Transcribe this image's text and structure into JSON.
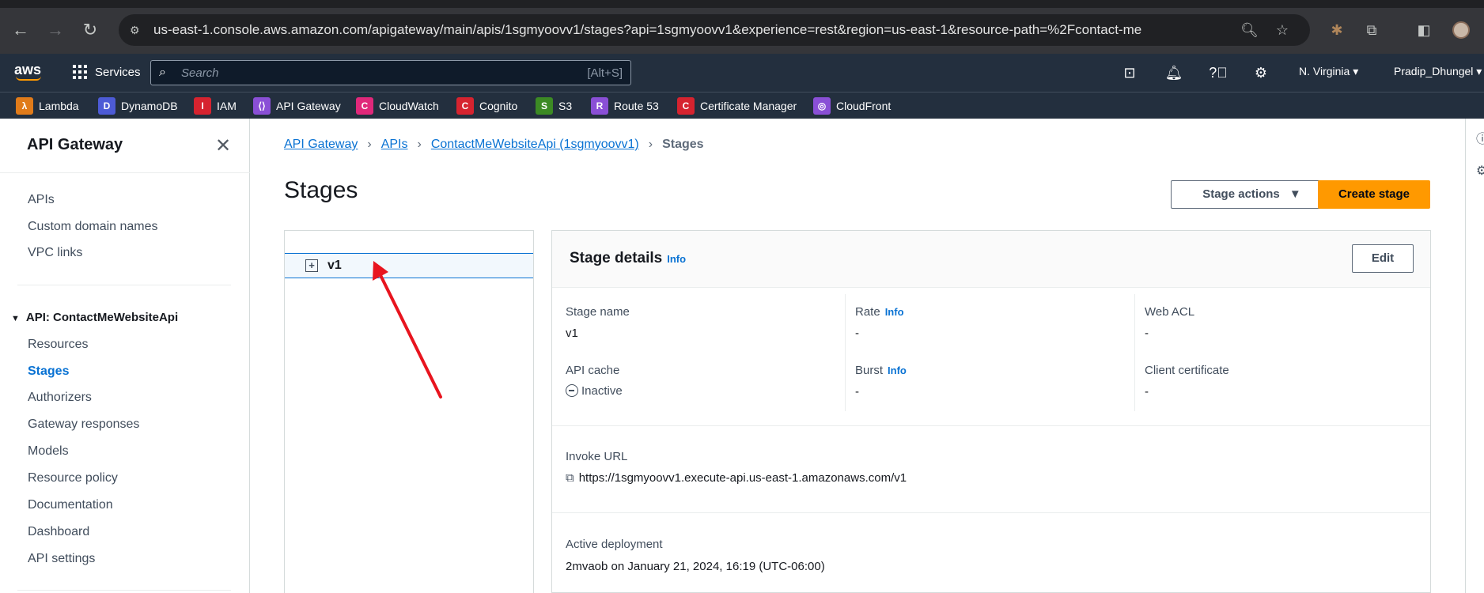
{
  "browser": {
    "url": "us-east-1.console.aws.amazon.com/apigateway/main/apis/1sgmyoovv1/stages?api=1sgmyoovv1&experience=rest&region=us-east-1&resource-path=%2Fcontact-me"
  },
  "awsnav": {
    "logo": "aws",
    "services_label": "Services",
    "search_placeholder": "Search",
    "search_shortcut": "[Alt+S]",
    "region": "N. Virginia ▾",
    "user": "Pradip_Dhungel ▾"
  },
  "favorites": [
    {
      "label": "Lambda",
      "color": "#e07b1a",
      "glyph": "λ"
    },
    {
      "label": "DynamoDB",
      "color": "#4d5bd6",
      "glyph": "D"
    },
    {
      "label": "IAM",
      "color": "#d6232f",
      "glyph": "I"
    },
    {
      "label": "API Gateway",
      "color": "#8a4fd6",
      "glyph": "⟨⟩"
    },
    {
      "label": "CloudWatch",
      "color": "#e0287a",
      "glyph": "C"
    },
    {
      "label": "Cognito",
      "color": "#d6232f",
      "glyph": "C"
    },
    {
      "label": "S3",
      "color": "#3c8a24",
      "glyph": "S"
    },
    {
      "label": "Route 53",
      "color": "#8a4fd6",
      "glyph": "R"
    },
    {
      "label": "Certificate Manager",
      "color": "#d6232f",
      "glyph": "C"
    },
    {
      "label": "CloudFront",
      "color": "#8a4fd6",
      "glyph": "◎"
    }
  ],
  "sidebar": {
    "title": "API Gateway",
    "top_items": [
      "APIs",
      "Custom domain names",
      "VPC links"
    ],
    "section": "API: ContactMeWebsiteApi",
    "items": [
      "Resources",
      "Stages",
      "Authorizers",
      "Gateway responses",
      "Models",
      "Resource policy",
      "Documentation",
      "Dashboard",
      "API settings"
    ],
    "active": "Stages"
  },
  "breadcrumb": {
    "items": [
      "API Gateway",
      "APIs",
      "ContactMeWebsiteApi (1sgmyoovv1)"
    ],
    "current": "Stages"
  },
  "page": {
    "title": "Stages",
    "stage_actions": "Stage actions",
    "create_stage": "Create stage"
  },
  "tree": {
    "stage": "v1"
  },
  "details": {
    "title": "Stage details",
    "info": "Info",
    "edit": "Edit",
    "stage_name_label": "Stage name",
    "stage_name": "v1",
    "rate_label": "Rate",
    "rate": "-",
    "web_acl_label": "Web ACL",
    "web_acl": "-",
    "api_cache_label": "API cache",
    "api_cache": "Inactive",
    "burst_label": "Burst",
    "burst": "-",
    "client_cert_label": "Client certificate",
    "client_cert": "-",
    "invoke_url_label": "Invoke URL",
    "invoke_url": "https://1sgmyoovv1.execute-api.us-east-1.amazonaws.com/v1",
    "active_deployment_label": "Active deployment",
    "active_deployment": "2mvaob on January 21, 2024, 16:19 (UTC-06:00)"
  },
  "colors": {
    "link": "#0972d3",
    "primary": "#ff9900",
    "annotation": "#e8141e"
  }
}
